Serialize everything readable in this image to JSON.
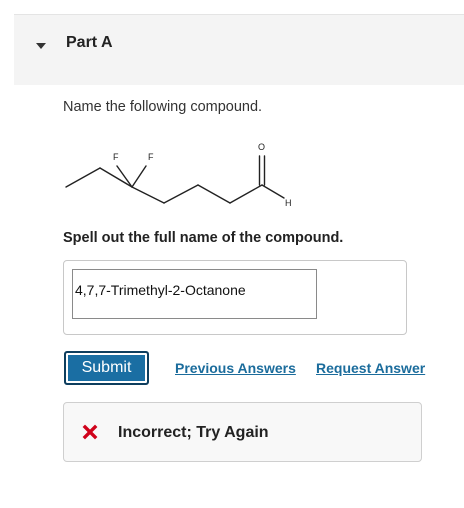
{
  "part": {
    "title": "Part A",
    "icon": "caret-down-icon"
  },
  "question": {
    "prompt": "Name the following compound.",
    "molecule_labels": {
      "fluorine_1": "F",
      "fluorine_2": "F",
      "oxygen": "O",
      "hydrogen": "H"
    },
    "instruction": "Spell out the full name of the compound."
  },
  "answer": {
    "value": "4,7,7-Trimethyl-2-Octanone"
  },
  "actions": {
    "submit_label": "Submit",
    "previous_answers_label": "Previous Answers",
    "request_answer_label": "Request Answer"
  },
  "feedback": {
    "text": "Incorrect; Try Again",
    "icon": "x-icon",
    "icon_color": "#d0021b"
  },
  "colors": {
    "accent": "#1a6ea3",
    "link": "#1b6c9c",
    "error": "#d0021b"
  }
}
